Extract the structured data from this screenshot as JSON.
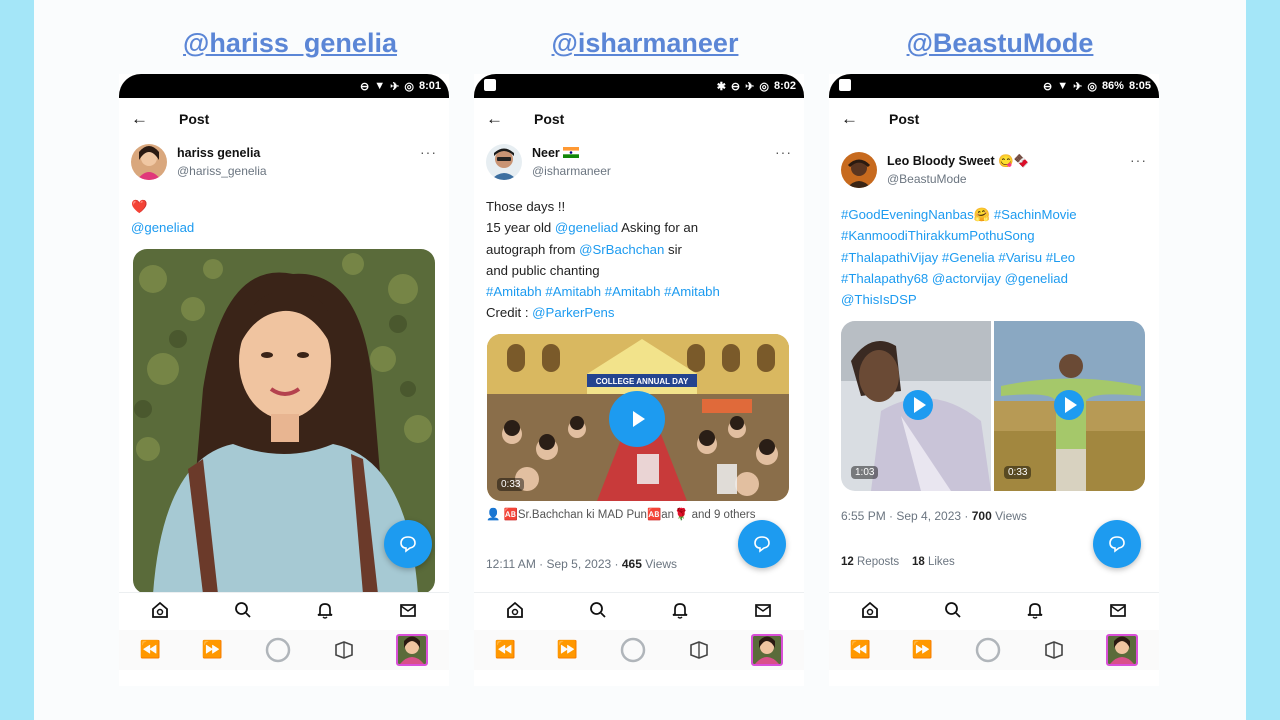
{
  "handles": [
    "@hariss_genelia",
    "@isharmaneer",
    "@BeastuMode"
  ],
  "nav_title": "Post",
  "status": {
    "p1_time": "8:01",
    "p2_time": "8:02",
    "p3_battery": "86%",
    "p3_time": "8:05"
  },
  "post1": {
    "name": "hariss genelia",
    "username": "@hariss_genelia",
    "emoji": "❤️",
    "mention": "@geneliad"
  },
  "post2": {
    "name": "Neer",
    "username": "@isharmaneer",
    "line1": "Those days !!",
    "line2a": "15 year old ",
    "line2b": "@geneliad",
    "line2c": " Asking for an",
    "line3a": "autograph from ",
    "line3b": "@SrBachchan",
    "line3c": " sir",
    "line4": "and public chanting",
    "line5": "#Amitabh #Amitabh #Amitabh #Amitabh",
    "line6a": "Credit : ",
    "line6b": "@ParkerPens",
    "banner": "COLLEGE ANNUAL DAY",
    "duration": "0:33",
    "likes": "👤 🆎Sr.Bachchan ki MAD Pun🆎an🌹 and 9 others",
    "time": "12:11 AM · Sep 5, 2023 · ",
    "views_count": "465",
    "views_label": " Views"
  },
  "post3": {
    "name": "Leo Bloody Sweet 😋🍫",
    "username": "@BeastuMode",
    "l1a": "#GoodEveningNanbas",
    "l1b": "🤗 ",
    "l1c": "#SachinMovie",
    "l2": "#KanmoodiThirakkumPothuSong",
    "l3": "#ThalapathiVijay #Genelia #Varisu #Leo",
    "l4": "#Thalapathy68 @actorvijay @geneliad",
    "l5": "@ThisIsDSP",
    "dur1": "1:03",
    "dur2": "0:33",
    "time": "6:55 PM · Sep 4, 2023 · ",
    "views_count": "700",
    "views_label": " Views",
    "reposts_count": "12",
    "reposts_label": " Reposts",
    "likes_count": "18",
    "likes_label": " Likes"
  }
}
